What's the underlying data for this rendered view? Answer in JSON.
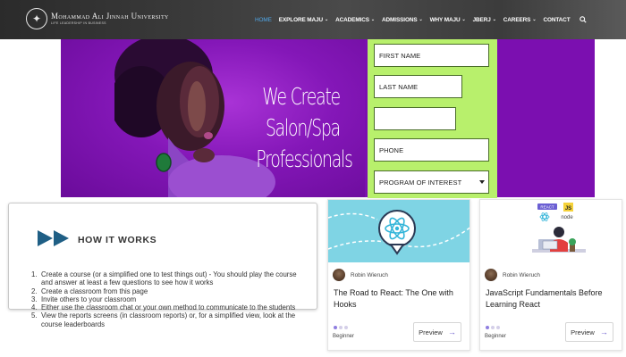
{
  "header": {
    "logo_name": "Mohammad Ali Jinnah University",
    "logo_tagline": "LIFE LEADERSHIP IN BUSINESS",
    "nav": [
      {
        "label": "HOME",
        "active": true,
        "has_caret": false
      },
      {
        "label": "EXPLORE MAJU",
        "active": false,
        "has_caret": true
      },
      {
        "label": "ACADEMICS",
        "active": false,
        "has_caret": true
      },
      {
        "label": "ADMISSIONS",
        "active": false,
        "has_caret": true
      },
      {
        "label": "WHY MAJU",
        "active": false,
        "has_caret": true
      },
      {
        "label": "JBERJ",
        "active": false,
        "has_caret": true
      },
      {
        "label": "CAREERS",
        "active": false,
        "has_caret": true
      },
      {
        "label": "CONTACT",
        "active": false,
        "has_caret": false
      }
    ],
    "search_icon": "search-icon",
    "accent_color": "#4fa6e6"
  },
  "hero": {
    "headline_lines": [
      "We Create",
      "Salon/Spa",
      "Professionals"
    ],
    "background_color": "#7b0fb0"
  },
  "form": {
    "background_color": "#b8f06c",
    "first_name_placeholder": "FIRST NAME",
    "last_name_placeholder": "LAST NAME",
    "blank_field_value": "",
    "phone_placeholder": "PHONE",
    "program_select": "PROGRAM OF INTEREST"
  },
  "how_it_works": {
    "title": "HOW IT WORKS",
    "icon": "fast-forward-icon",
    "steps": [
      "Create a course (or a simplified one to test things out) - You should play the course and answer at least a few questions to see how it works",
      "Create a classroom from this page",
      "Invite others to your classroom",
      "Either use the classroom chat or your own method to communicate to the students",
      "View the reports screens (in classroom reports) or, for a simplified view, look at the course leaderboards"
    ]
  },
  "courses": [
    {
      "author": "Robin Wieruch",
      "title": "The Road to React: The One with Hooks",
      "level": "Beginner",
      "preview_label": "Preview",
      "thumb_bg": "#7fd4e4"
    },
    {
      "author": "Robin Wieruch",
      "title": "JavaScript Fundamentals Before Learning React",
      "level": "Beginner",
      "preview_label": "Preview",
      "thumb_bg": "#ffffff",
      "tags": [
        "REACT",
        "JS",
        "node"
      ]
    }
  ]
}
